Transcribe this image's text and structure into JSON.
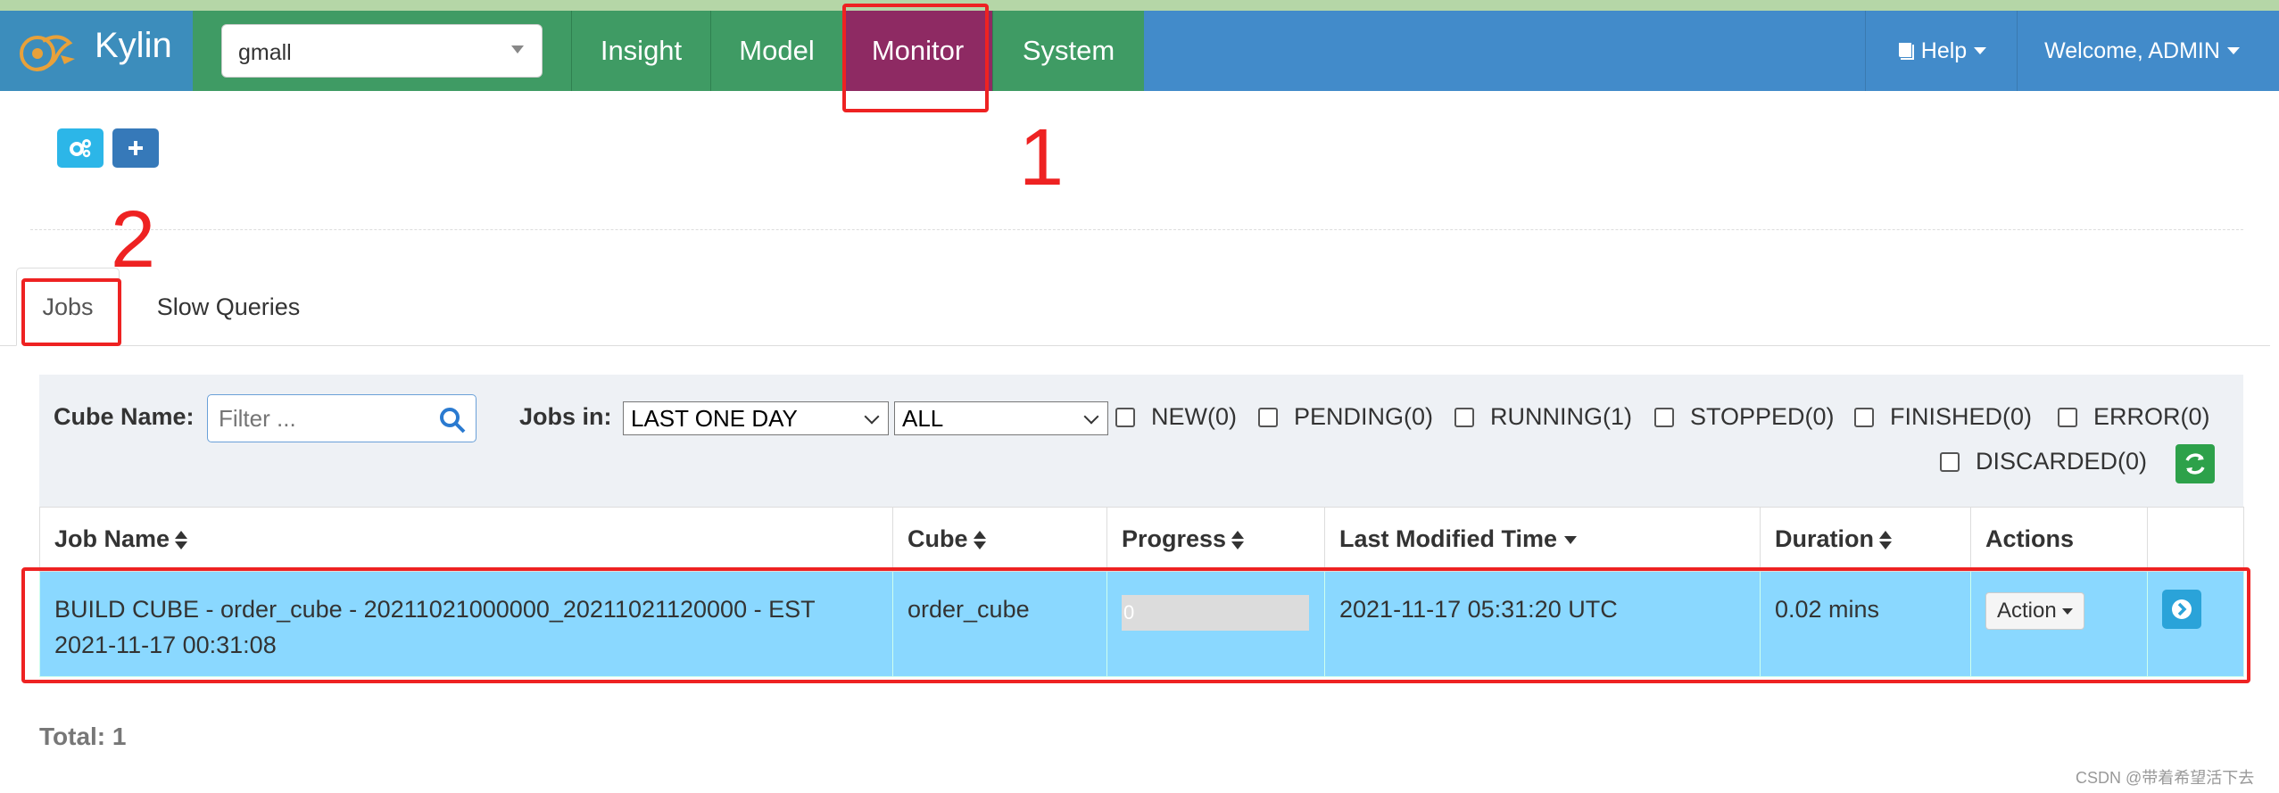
{
  "app": {
    "title": "Kylin"
  },
  "project": {
    "selected": "gmall"
  },
  "nav": {
    "tabs": [
      {
        "label": "Insight"
      },
      {
        "label": "Model"
      },
      {
        "label": "Monitor"
      },
      {
        "label": "System"
      }
    ],
    "active": "Monitor",
    "help": "Help",
    "user": "Welcome, ADMIN"
  },
  "toolbar": {
    "icons": [
      "gears-icon",
      "plus-icon"
    ]
  },
  "subtabs": [
    {
      "label": "Jobs"
    },
    {
      "label": "Slow Queries"
    }
  ],
  "filters": {
    "cube_name_label": "Cube Name:",
    "cube_name_placeholder": "Filter ...",
    "jobs_in_label": "Jobs in:",
    "time_range": "LAST ONE DAY",
    "status_select": "ALL",
    "statuses": [
      "NEW(0)",
      "PENDING(0)",
      "RUNNING(1)",
      "STOPPED(0)",
      "FINISHED(0)",
      "ERROR(0)",
      "DISCARDED(0)"
    ]
  },
  "table": {
    "headers": [
      "Job Name",
      "Cube",
      "Progress",
      "Last Modified Time",
      "Duration",
      "Actions"
    ],
    "rows": [
      {
        "job_name": "BUILD CUBE - order_cube - 20211021000000_20211021120000 - EST 2021-11-17 00:31:08",
        "cube": "order_cube",
        "progress": "0",
        "progress_value": 0,
        "last_modified": "2021-11-17 05:31:20 UTC",
        "duration": "0.02 mins",
        "action_label": "Action"
      }
    ]
  },
  "total": "Total: 1",
  "annotations": {
    "one": "1",
    "two": "2"
  },
  "watermark": "CSDN @带着希望活下去",
  "colors": {
    "navbar": "#428bca",
    "green": "#3f9b64",
    "active": "#8e2a63",
    "row": "#8ad8ff",
    "annotation": "#ee2222"
  }
}
